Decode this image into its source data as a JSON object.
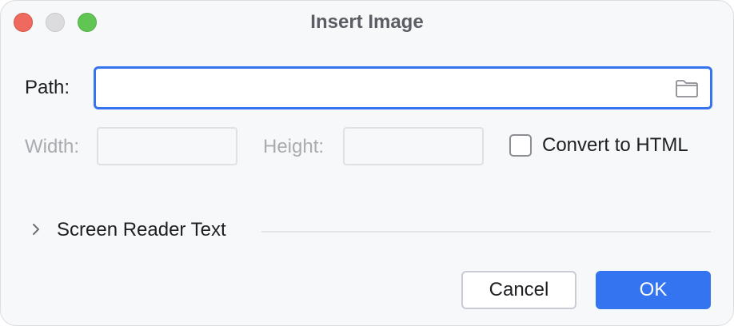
{
  "window": {
    "title": "Insert Image"
  },
  "path": {
    "label": "Path:",
    "value": "",
    "placeholder": ""
  },
  "dimensions": {
    "width_label": "Width:",
    "width_value": "",
    "height_label": "Height:",
    "height_value": ""
  },
  "convert": {
    "label": "Convert to HTML",
    "checked": false
  },
  "screen_reader": {
    "label": "Screen Reader Text",
    "expanded": false
  },
  "buttons": {
    "cancel_label": "Cancel",
    "ok_label": "OK"
  },
  "colors": {
    "accent": "#3574f0",
    "background": "#f7f8fa",
    "disabled_text": "#a9abb0"
  },
  "icons": {
    "folder": "folder-icon",
    "chevron": "chevron-right-icon"
  }
}
